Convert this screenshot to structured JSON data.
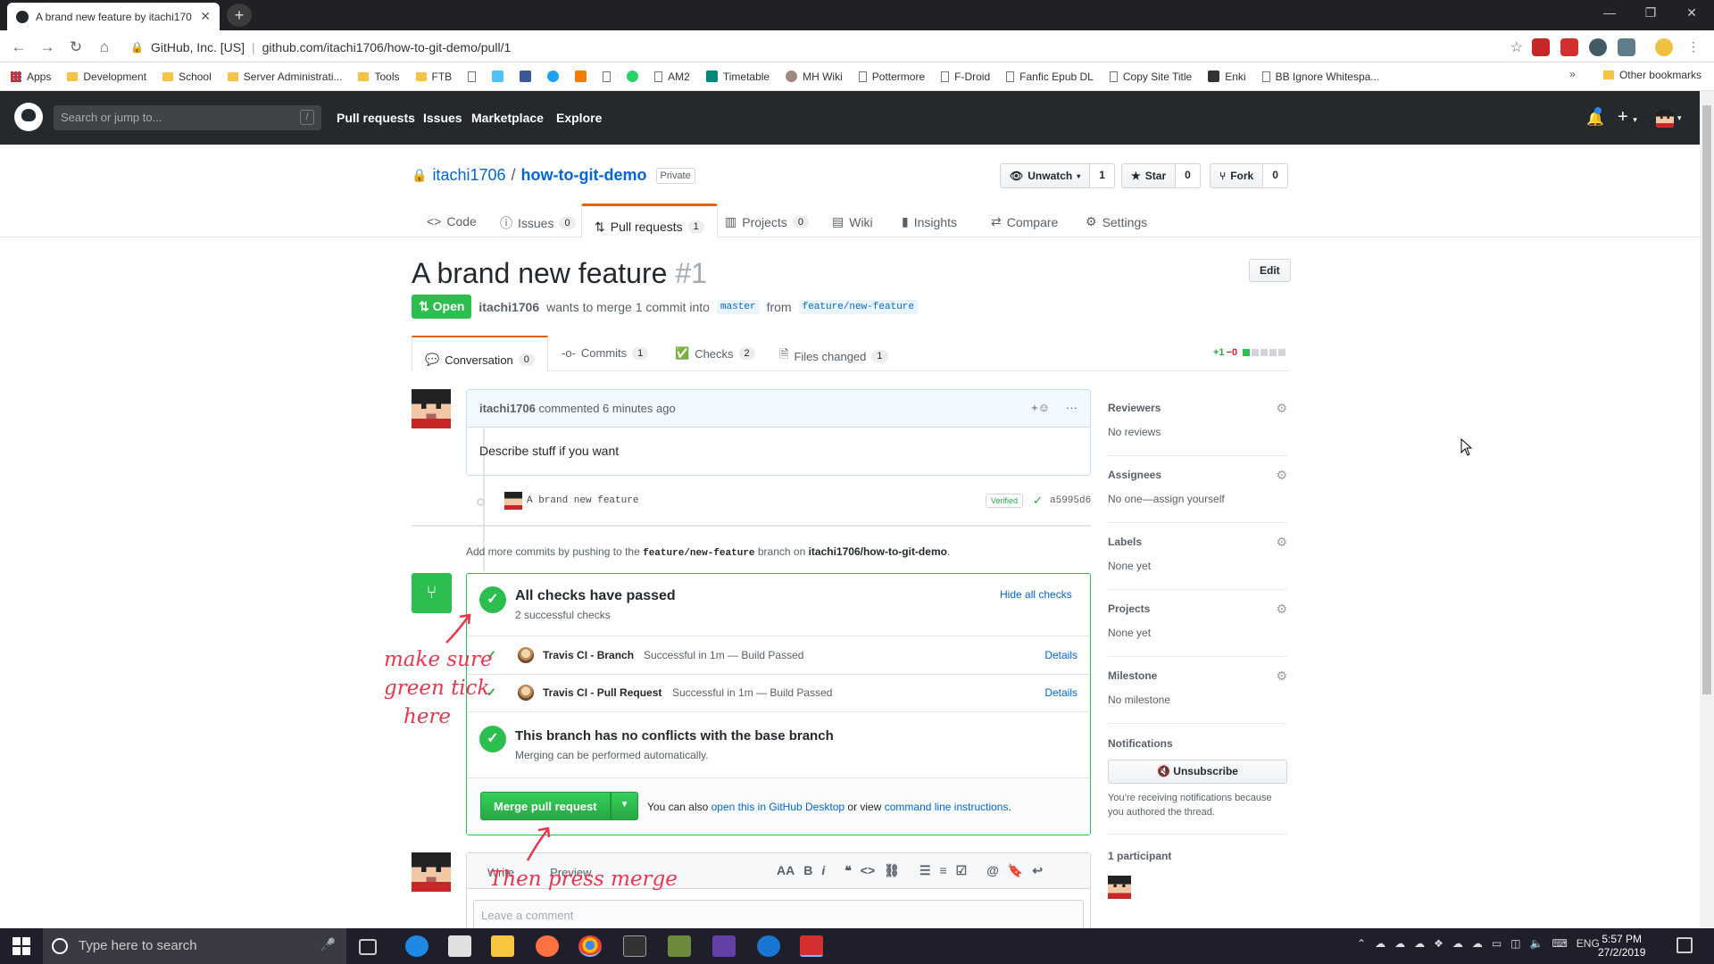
{
  "browser": {
    "tab_title": "A brand new feature by itachi170",
    "org": "GitHub, Inc. [US]",
    "url": "github.com/itachi1706/how-to-git-demo/pull/1",
    "bookmarks": [
      "Apps",
      "Development",
      "School",
      "Server Administrati...",
      "Tools",
      "FTB",
      "AM2",
      "Timetable",
      "MH Wiki",
      "Pottermore",
      "F-Droid",
      "Fanfic Epub DL",
      "Copy Site Title",
      "Enki",
      "BB Ignore Whitespa..."
    ],
    "other_bookmarks": "Other bookmarks"
  },
  "gh": {
    "search_placeholder": "Search or jump to...",
    "search_key": "/",
    "nav": [
      "Pull requests",
      "Issues",
      "Marketplace",
      "Explore"
    ]
  },
  "repo": {
    "owner": "itachi1706",
    "name": "how-to-git-demo",
    "visibility": "Private",
    "unwatch": "Unwatch",
    "unwatch_count": "1",
    "star": "Star",
    "star_count": "0",
    "fork": "Fork",
    "fork_count": "0",
    "tabs": [
      {
        "label": "Code",
        "count": ""
      },
      {
        "label": "Issues",
        "count": "0"
      },
      {
        "label": "Pull requests",
        "count": "1"
      },
      {
        "label": "Projects",
        "count": "0"
      },
      {
        "label": "Wiki",
        "count": ""
      },
      {
        "label": "Insights",
        "count": ""
      },
      {
        "label": "Compare",
        "count": ""
      },
      {
        "label": "Settings",
        "count": ""
      }
    ]
  },
  "pr": {
    "title": "A brand new feature",
    "number": "#1",
    "edit": "Edit",
    "state": "Open",
    "author": "itachi1706",
    "merge_text": "wants to merge 1 commit into",
    "base": "master",
    "from": "from",
    "head": "feature/new-feature",
    "tabs": [
      {
        "label": "Conversation",
        "count": "0"
      },
      {
        "label": "Commits",
        "count": "1"
      },
      {
        "label": "Checks",
        "count": "2"
      },
      {
        "label": "Files changed",
        "count": "1"
      }
    ],
    "diff_add": "+1",
    "diff_del": "−0"
  },
  "comment": {
    "author": "itachi1706",
    "when": "commented 6 minutes ago",
    "body": "Describe stuff if you want",
    "commit_msg": "A brand new feature",
    "verified": "Verified",
    "sha": "a5995d6"
  },
  "addmore": {
    "pre": "Add more commits by pushing to the",
    "branch": "feature/new-feature",
    "mid": "branch on",
    "repo": "itachi1706/how-to-git-demo",
    "end": "."
  },
  "merge": {
    "checks_title": "All checks have passed",
    "checks_sub": "2 successful checks",
    "hide": "Hide all checks",
    "checks": [
      {
        "name": "Travis CI - Branch",
        "status": "Successful in 1m — Build Passed",
        "details": "Details"
      },
      {
        "name": "Travis CI - Pull Request",
        "status": "Successful in 1m — Build Passed",
        "details": "Details"
      }
    ],
    "conflict_title": "This branch has no conflicts with the base branch",
    "conflict_sub": "Merging can be performed automatically.",
    "button": "Merge pull request",
    "alt_pre": "You can also",
    "alt_link1": "open this in GitHub Desktop",
    "alt_mid": "or view",
    "alt_link2": "command line instructions",
    "alt_end": "."
  },
  "composer": {
    "write": "Write",
    "preview": "Preview",
    "placeholder": "Leave a comment"
  },
  "sidebar": {
    "reviewers": "Reviewers",
    "reviewers_v": "No reviews",
    "assignees": "Assignees",
    "assignees_v": "No one—assign yourself",
    "labels": "Labels",
    "labels_v": "None yet",
    "projects": "Projects",
    "projects_v": "None yet",
    "milestone": "Milestone",
    "milestone_v": "No milestone",
    "notifications": "Notifications",
    "unsubscribe": "Unsubscribe",
    "notif_text": "You’re receiving notifications because you authored the thread.",
    "participants": "1 participant"
  },
  "annotations": {
    "tick_note": [
      "make sure",
      "green tick",
      "here"
    ],
    "merge_note": "Then press merge"
  },
  "taskbar": {
    "search": "Type here to search",
    "lang": "ENG",
    "time": "5:57 PM",
    "date": "27/2/2019"
  }
}
